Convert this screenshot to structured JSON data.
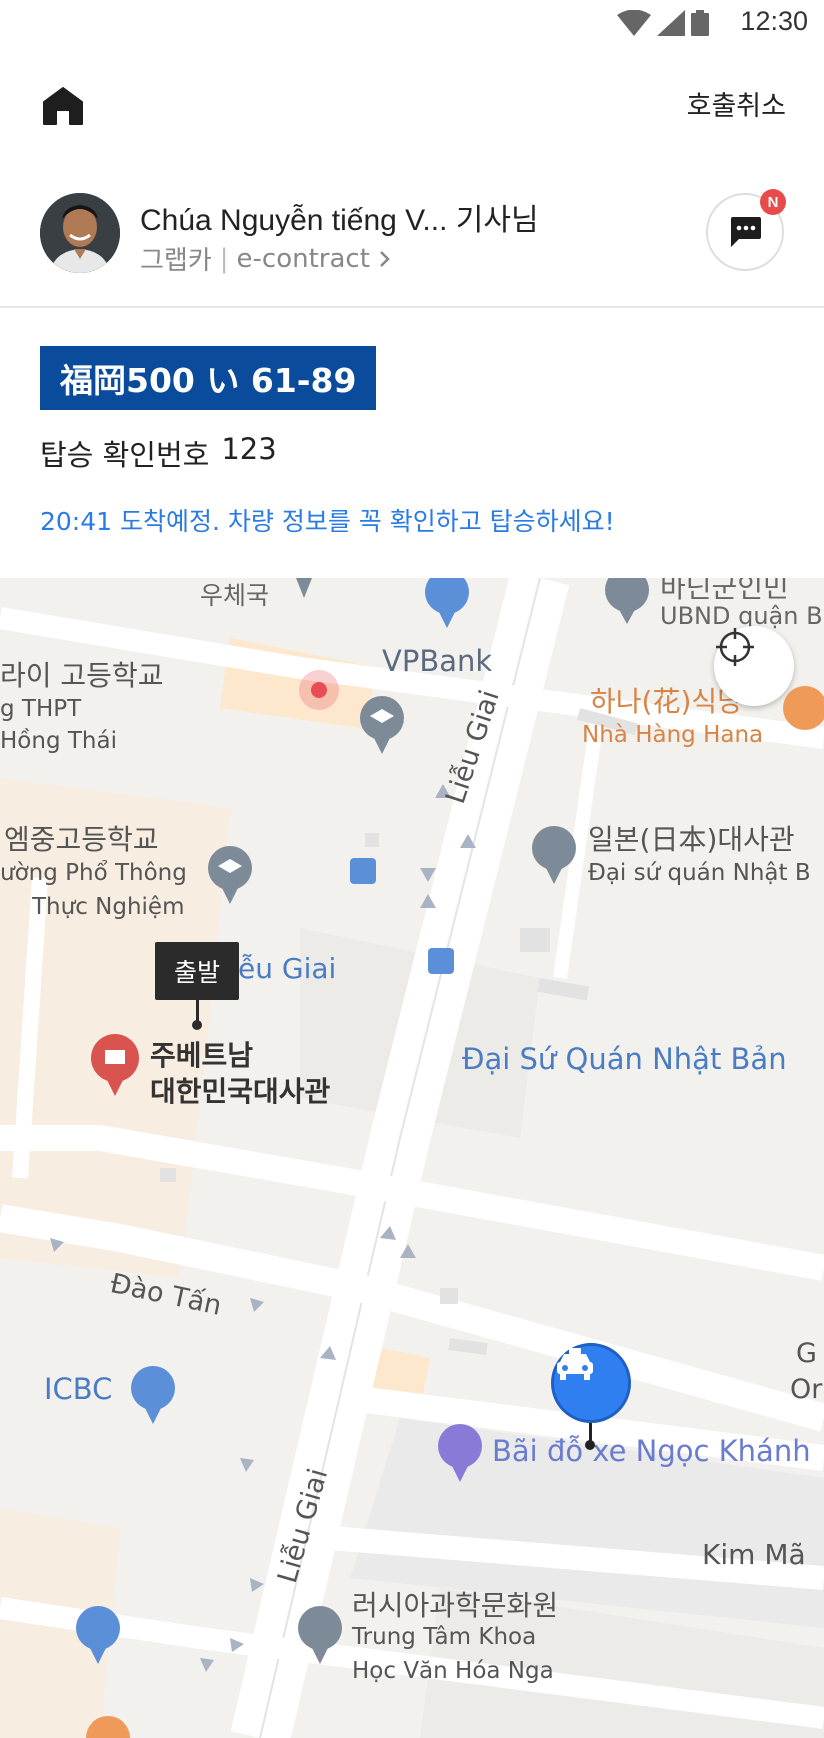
{
  "status_bar": {
    "time": "12:30"
  },
  "header": {
    "cancel_label": "호출취소"
  },
  "driver": {
    "name": "Chúa Nguyễn tiếng V... 기사님",
    "service": "그랩카",
    "contract": "e-contract",
    "chat_badge": "N"
  },
  "vehicle": {
    "plate": "福岡500 い 61-89",
    "confirm_label": "탑승 확인번호",
    "confirm_number": "123",
    "eta_message": "20:41 도착예정. 차량 정보를 꼭 확인하고 탑승하세요!"
  },
  "map": {
    "depart_label": "출발",
    "labels": {
      "post_office": "우체국",
      "vpbank": "VPBank",
      "ubnd_ko": "바딘군인민",
      "ubnd_vi": "UBND quận B",
      "school1_ko": "라이 고등학교",
      "school1_vi1": "g THPT",
      "school1_vi2": "Hồng Thái",
      "hana_ko": "하나(花)식당",
      "hana_vi": "Nhà Hàng Hana",
      "lieu_giai_top": "Liễu Giai",
      "school2_ko": "엠중고등학교",
      "school2_vi1": "ường Phổ Thông",
      "school2_vi2": "Thực Nghiệm",
      "japan_ko": "일본(日本)대사관",
      "japan_vi": "Đại sứ quán Nhật B",
      "lieu_giai_bus": "ễu Giai",
      "embassy_ko1": "주베트남",
      "embassy_ko2": "대한민국대사관",
      "japan_bus": "Đại Sứ Quán Nhật Bản",
      "dao_tan": "Đào Tấn",
      "icbc": "ICBC",
      "gc": "G",
      "or": "Or",
      "parking": "Bãi đỗ xe Ngọc Khánh",
      "lieu_giai_bottom": "Liễu Giai",
      "kim_ma": "Kim Mã",
      "russia_ko": "러시아과학문화원",
      "russia_vi1": "Trung Tâm Khoa",
      "russia_vi2": "Học Văn Hóa Nga"
    }
  },
  "colors": {
    "plate_bg": "#0a4b9c",
    "eta_text": "#2a7be4",
    "taxi_pin": "#2f7ff0",
    "badge": "#e84b4b"
  }
}
